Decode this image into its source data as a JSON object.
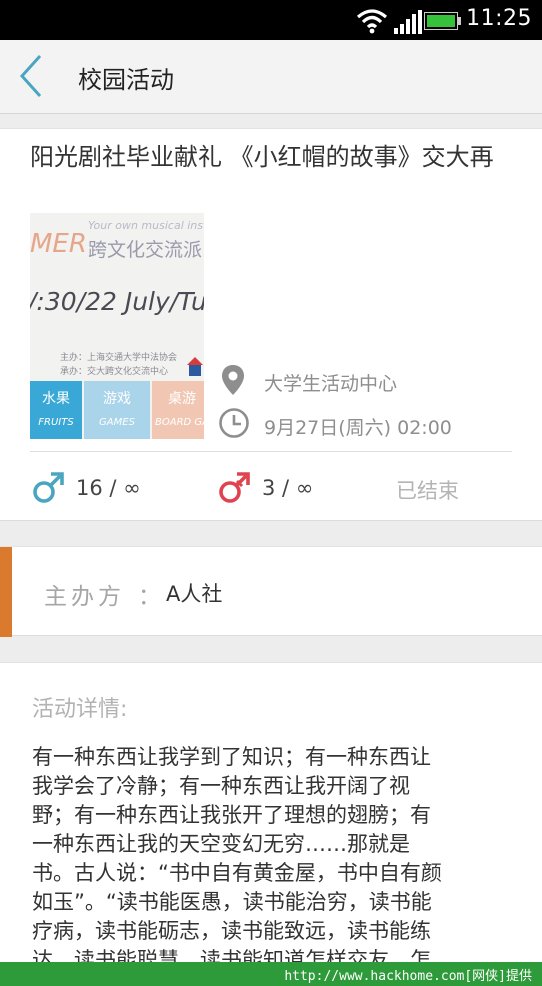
{
  "status_bar": {
    "time": "11:25",
    "icons": [
      "wifi-icon",
      "signal-icon",
      "battery-icon"
    ]
  },
  "header": {
    "title": "校园活动",
    "back_icon": "chevron-left-icon",
    "accent_color": "#4aa6c0"
  },
  "event": {
    "title": "阳光剧社毕业献礼 《小红帽的故事》交大再",
    "poster": {
      "en_text": "Your own musical instr",
      "er_text": "MER",
      "cn_text": "跨文化交流派",
      "date_text": "/:30/22 July/Tu",
      "org_line1": "主办：上海交通大学中法协会",
      "org_line2": "承办：交大跨文化交流中心",
      "tiles": [
        {
          "cn": "水果",
          "en": "FRUITS",
          "color": "#39a8d6"
        },
        {
          "cn": "游戏",
          "en": "GAMES",
          "color": "#a9d4ea"
        },
        {
          "cn": "桌游",
          "en": "BOARD GA",
          "color": "#f1c7b3"
        }
      ]
    },
    "location": "大学生活动中心",
    "time": "9月27日(周六) 02:00",
    "male_count": "16 / ∞",
    "female_count": "3 / ∞",
    "status": "已结束",
    "male_color": "#4aa6c0",
    "female_color": "#e0434f"
  },
  "organizer": {
    "label": "主办方",
    "colon": "：",
    "value": "A人社",
    "accent_color": "#d97a2e"
  },
  "detail": {
    "label": "活动详情:",
    "lines": [
      "有一种东西让我学到了知识；有一种东西让",
      "我学会了冷静；有一种东西让我开阔了视",
      "野；有一种东西让我张开了理想的翅膀；有",
      "一种东西让我的天空变幻无穷……那就是",
      "书。古人说：“书中自有黄金屋，书中自有颜",
      "如玉”。“读书能医愚，读书能治穷，读书能",
      "疗病，读书能砺志，读书能致远，读书能练",
      "达，读书能聪慧，读书能知道怎样交友，怎"
    ]
  },
  "watermark": {
    "text": "http://www.hackhome.com[网侠]提供"
  }
}
